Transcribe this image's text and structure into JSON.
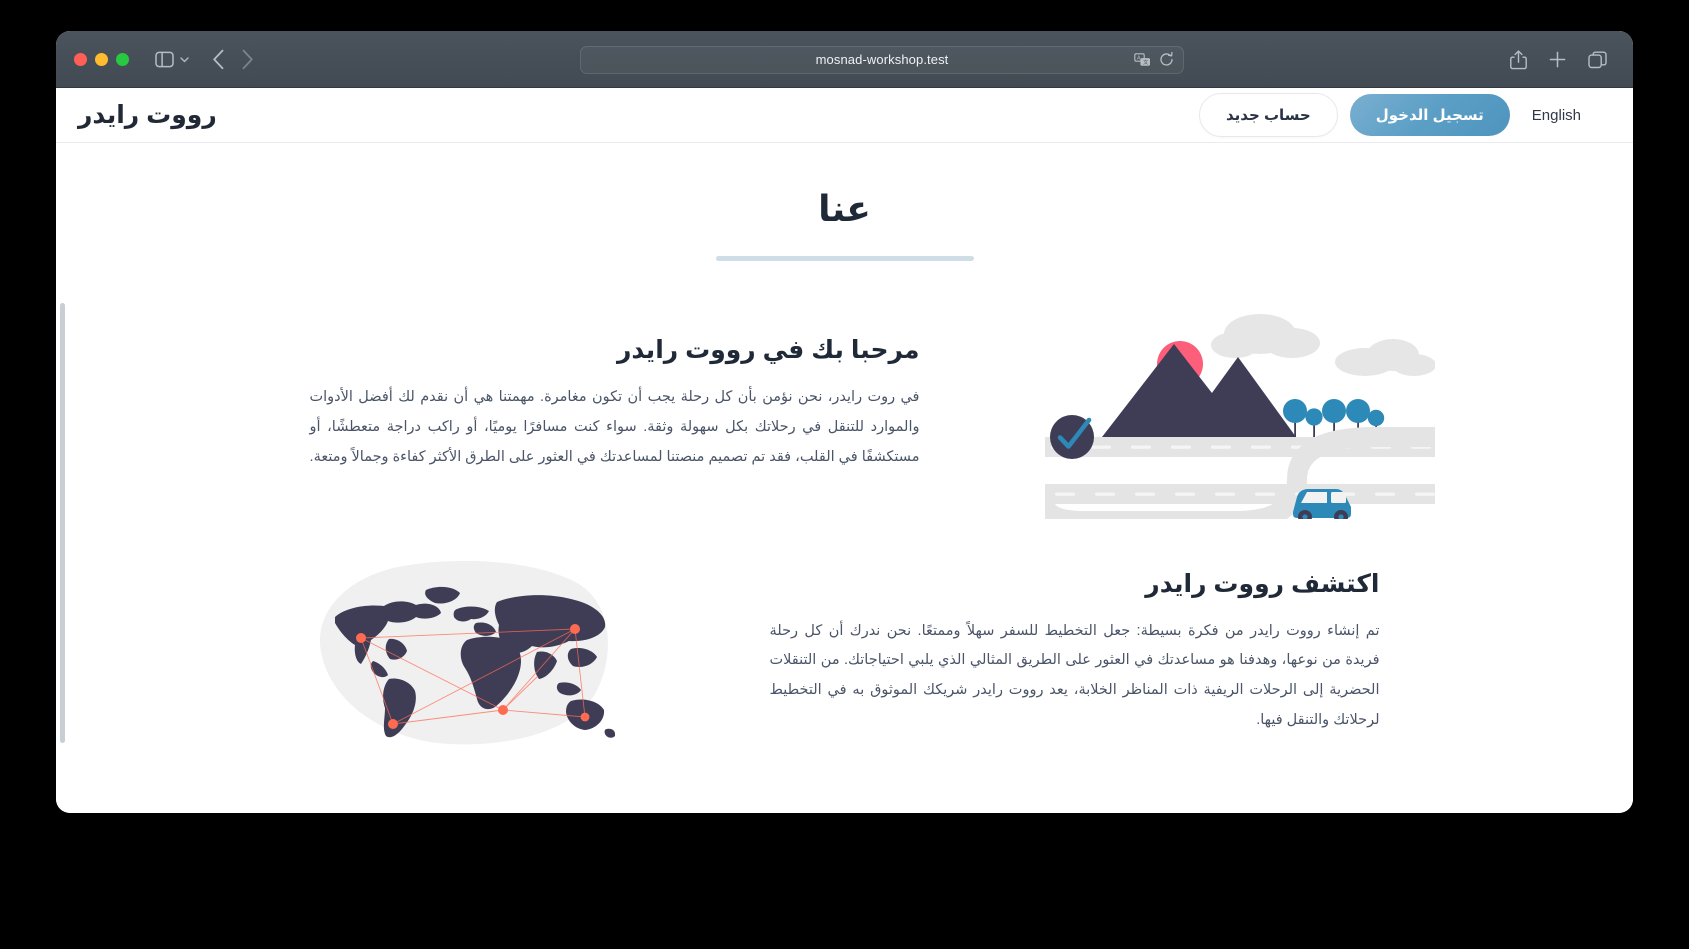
{
  "browser": {
    "url": "mosnad-workshop.test",
    "traffic_lights": [
      "close",
      "minimize",
      "maximize"
    ],
    "icons": {
      "sidebar": "sidebar-icon",
      "sidebar_chevron": "chevron-down-icon",
      "back": "back-arrow-icon",
      "forward": "forward-arrow-icon",
      "translate": "translate-icon",
      "reload": "reload-icon",
      "share": "share-icon",
      "new_tab": "plus-icon",
      "tab_overview": "tab-overview-icon"
    }
  },
  "site": {
    "brand": "رووت رايدر",
    "nav": {
      "register_label": "حساب جديد",
      "login_label": "تسجيل الدخول",
      "language_label": "English"
    },
    "page_title": "عنا"
  },
  "sections": [
    {
      "heading": "مرحبا بك في رووت رايدر",
      "body": "في روت رايدر، نحن نؤمن بأن كل رحلة يجب أن تكون مغامرة. مهمتنا هي أن نقدم لك أفضل الأدوات والموارد للتنقل في رحلاتك بكل سهولة وثقة. سواء كنت مسافرًا يوميًا، أو راكب دراجة متعطشًا، أو مستكشفًا في القلب، فقد تم تصميم منصتنا لمساعدتك في العثور على الطرق الأكثر كفاءة وجمالاً ومتعة.",
      "art": "mountain-road-illustration"
    },
    {
      "heading": "اكتشف رووت رايدر",
      "body": "تم إنشاء رووت رايدر من فكرة بسيطة: جعل التخطيط للسفر سهلاً وممتعًا. نحن ندرك أن كل رحلة فريدة من نوعها، وهدفنا هو مساعدتك في العثور على الطريق المثالي الذي يلبي احتياجاتك. من التنقلات الحضرية إلى الرحلات الريفية ذات المناظر الخلابة، يعد رووت رايدر شريكك الموثوق به في التخطيط لرحلاتك والتنقل فيها.",
      "art": "world-map-illustration"
    }
  ],
  "colors": {
    "brand_dark": "#2f2e41",
    "accent_blue": "#4e94bd",
    "title_rule": "#cfdde7",
    "sun_pink": "#fd5f7a",
    "map_dot_orange": "#ff6b52",
    "road_gray": "#e4e4e4",
    "text_body": "#4a5568"
  }
}
